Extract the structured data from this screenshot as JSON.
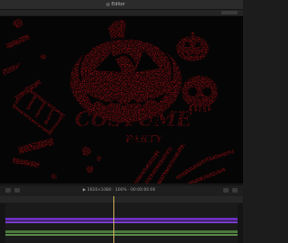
{
  "window": {
    "title": "Editor"
  },
  "canvas": {
    "artwork_title": "COSTUME",
    "artwork_subtitle": "PARTY",
    "accent_color": "#e0141b"
  },
  "viewer_controls": {
    "status_text": "▶  1920×1080  ·  100%  ·  00:00:00:00"
  },
  "timeline": {
    "tracks": [
      {
        "kind": "video",
        "color": "#6a2fbf"
      },
      {
        "kind": "video",
        "color": "#7b3cd6"
      },
      {
        "kind": "audio",
        "color": "#4a7a3a"
      },
      {
        "kind": "audio",
        "color": "#5a8a48"
      }
    ]
  }
}
